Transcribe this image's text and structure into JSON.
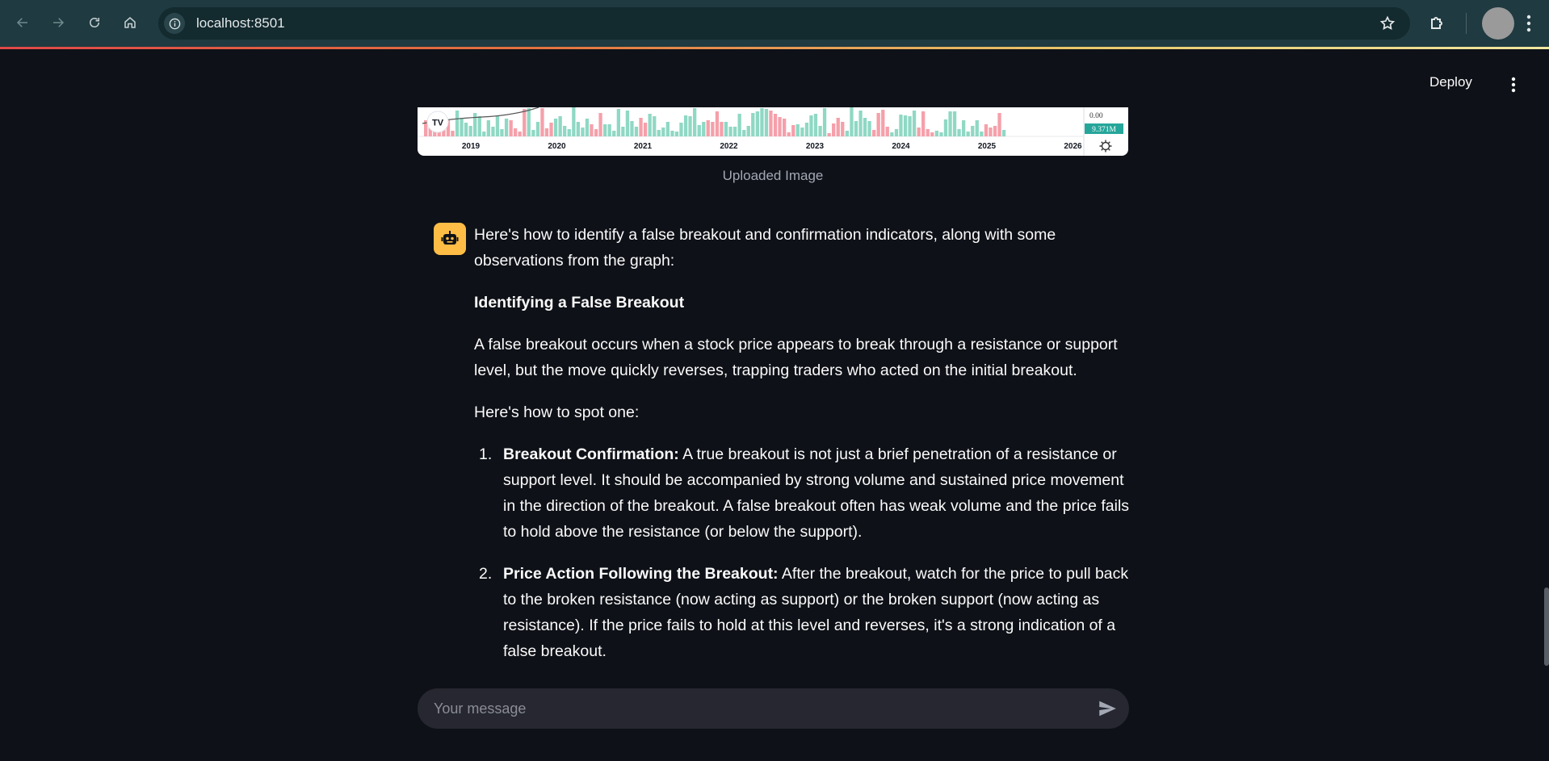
{
  "browser": {
    "url": "localhost:8501",
    "icons": [
      "back-icon",
      "forward-icon",
      "reload-icon",
      "home-icon",
      "info-icon",
      "star-icon",
      "extensions-icon",
      "profile-avatar",
      "more-icon"
    ]
  },
  "header": {
    "deploy_label": "Deploy"
  },
  "chart_image": {
    "years": [
      "2019",
      "2020",
      "2021",
      "2022",
      "2023",
      "2024",
      "2025",
      "2026"
    ],
    "price_label": "0.00",
    "volume_badge": "9.371M",
    "logo_text": "TV",
    "bar_colors": {
      "up": "#8fd8c4",
      "down": "#f5a0aa"
    }
  },
  "caption": "Uploaded Image",
  "message": {
    "intro": "Here's how to identify a false breakout and confirmation indicators, along with some observations from the graph:",
    "heading": "Identifying a False Breakout",
    "definition": "A false breakout occurs when a stock price appears to break through a resistance or support level, but the move quickly reverses, trapping traders who acted on the initial breakout.",
    "spot_intro": "Here's how to spot one:",
    "items": [
      {
        "num": "1.",
        "title": "Breakout Confirmation:",
        "text": " A true breakout is not just a brief penetration of a resistance or support level. It should be accompanied by strong volume and sustained price movement in the direction of the breakout. A false breakout often has weak volume and the price fails to hold above the resistance (or below the support)."
      },
      {
        "num": "2.",
        "title": "Price Action Following the Breakout:",
        "text": " After the breakout, watch for the price to pull back to the broken resistance (now acting as support) or the broken support (now acting as resistance). If the price fails to hold at this level and reverses, it's a strong indication of a false breakout."
      }
    ]
  },
  "chat_input": {
    "placeholder": "Your message"
  },
  "colors": {
    "background": "#0e1117",
    "bot_avatar": "#ffbd45",
    "input_bg": "#262730"
  }
}
